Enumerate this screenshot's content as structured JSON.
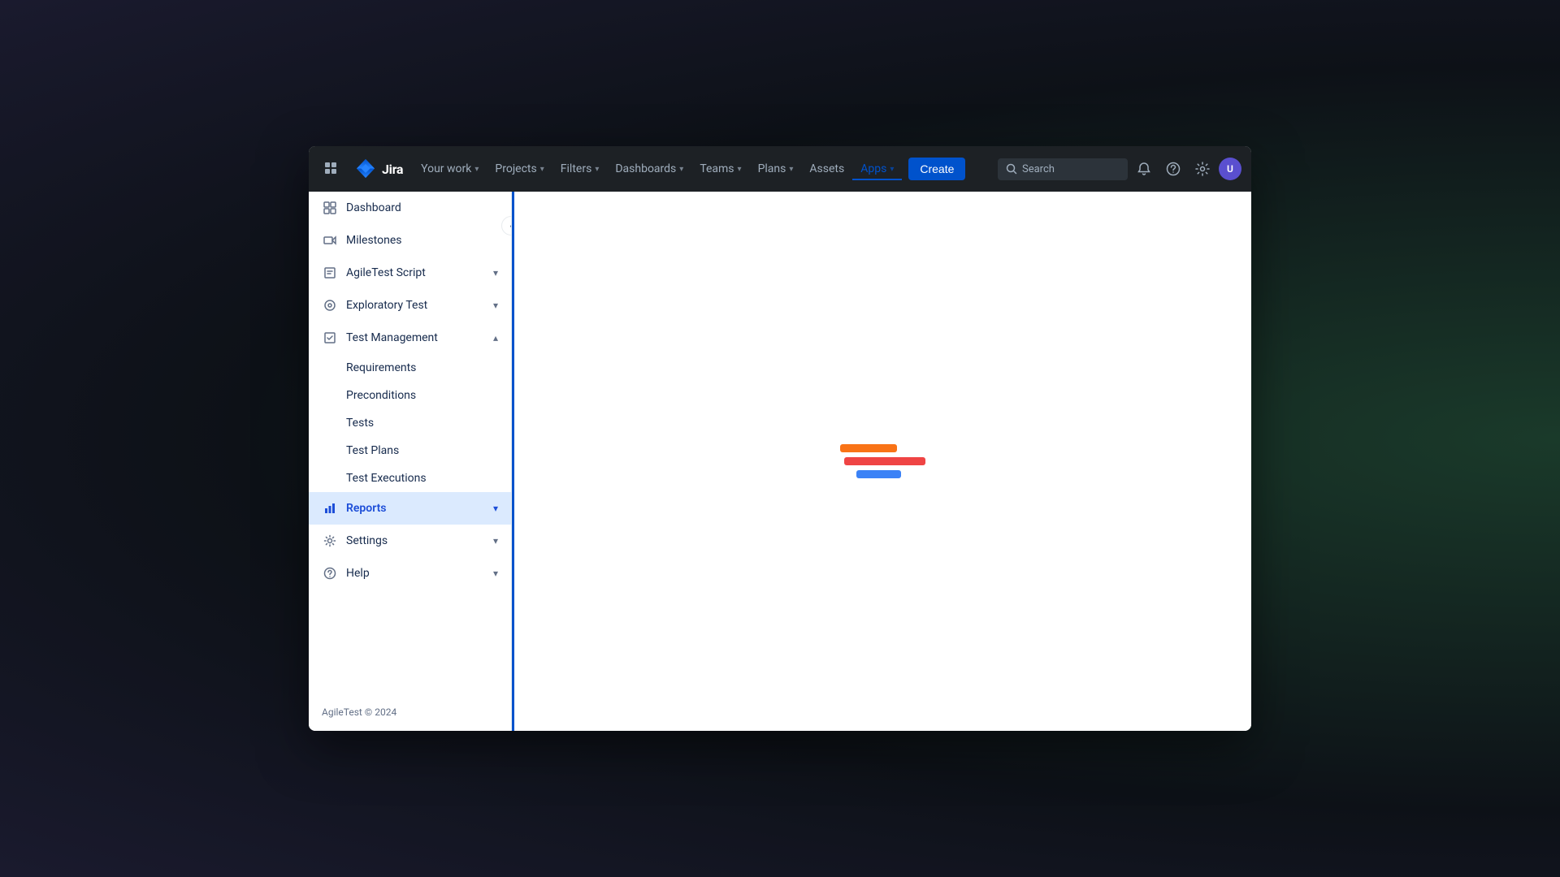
{
  "navbar": {
    "apps_icon_label": "Apps menu",
    "logo_text": "Jira",
    "nav_items": [
      {
        "id": "your-work",
        "label": "Your work",
        "has_chevron": true,
        "active": false
      },
      {
        "id": "projects",
        "label": "Projects",
        "has_chevron": true,
        "active": false
      },
      {
        "id": "filters",
        "label": "Filters",
        "has_chevron": true,
        "active": false
      },
      {
        "id": "dashboards",
        "label": "Dashboards",
        "has_chevron": true,
        "active": false
      },
      {
        "id": "teams",
        "label": "Teams",
        "has_chevron": true,
        "active": false
      },
      {
        "id": "plans",
        "label": "Plans",
        "has_chevron": true,
        "active": false
      },
      {
        "id": "assets",
        "label": "Assets",
        "has_chevron": false,
        "active": false
      },
      {
        "id": "apps",
        "label": "Apps",
        "has_chevron": true,
        "active": true
      }
    ],
    "create_label": "Create",
    "search_placeholder": "Search",
    "accent_color": "#0052cc"
  },
  "sidebar": {
    "items": [
      {
        "id": "dashboard",
        "label": "Dashboard",
        "icon": "dashboard",
        "expandable": false,
        "active": false
      },
      {
        "id": "milestones",
        "label": "Milestones",
        "icon": "milestones",
        "expandable": false,
        "active": false
      },
      {
        "id": "agiletest-script",
        "label": "AgileTest Script",
        "icon": "script",
        "expandable": true,
        "expanded": false,
        "active": false
      },
      {
        "id": "exploratory-test",
        "label": "Exploratory Test",
        "icon": "exploratory",
        "expandable": true,
        "expanded": false,
        "active": false
      },
      {
        "id": "test-management",
        "label": "Test Management",
        "icon": "testmgmt",
        "expandable": true,
        "expanded": true,
        "active": false
      },
      {
        "id": "reports",
        "label": "Reports",
        "icon": "reports",
        "expandable": true,
        "expanded": false,
        "active": true
      },
      {
        "id": "settings",
        "label": "Settings",
        "icon": "settings",
        "expandable": true,
        "expanded": false,
        "active": false
      },
      {
        "id": "help",
        "label": "Help",
        "icon": "help",
        "expandable": true,
        "expanded": false,
        "active": false
      }
    ],
    "sub_items": [
      {
        "id": "requirements",
        "label": "Requirements"
      },
      {
        "id": "preconditions",
        "label": "Preconditions"
      },
      {
        "id": "tests",
        "label": "Tests"
      },
      {
        "id": "test-plans",
        "label": "Test Plans"
      },
      {
        "id": "test-executions",
        "label": "Test Executions"
      }
    ],
    "footer_text": "AgileTest © 2024"
  },
  "main": {
    "loading": true
  }
}
